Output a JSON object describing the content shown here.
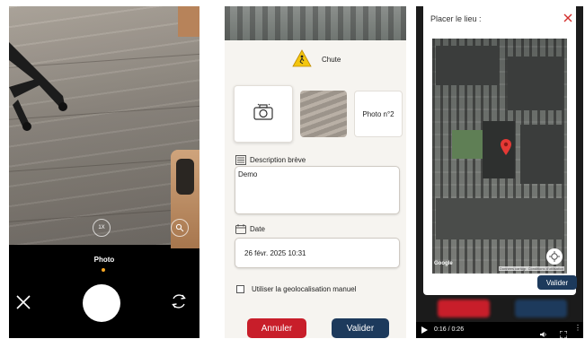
{
  "camera": {
    "mode_label": "Photo",
    "zoom_label": "1X",
    "accent": "#f5a623"
  },
  "form": {
    "incident_type": "Chute",
    "photo2_label": "Photo n°2",
    "description_label": "Description brève",
    "description_value": "Demo",
    "date_label": "Date",
    "date_value": "26 févr. 2025 10:31",
    "geoloc_label": "Utiliser la geolocalisation manuel",
    "cancel_label": "Annuler",
    "validate_label": "Valider",
    "cancel_color": "#c81e2a",
    "validate_color": "#1d3a5c"
  },
  "place_modal": {
    "title": "Placer le lieu :",
    "validate_label": "Valider",
    "google_label": "Google",
    "attribution": "Données cartogr. Conditions d'utilisation"
  },
  "player": {
    "time": "0:16 / 0:26"
  }
}
